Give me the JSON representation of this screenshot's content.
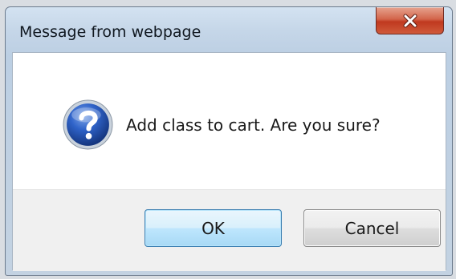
{
  "dialog": {
    "title": "Message from webpage",
    "message": "Add class to cart. Are you sure?",
    "icon": "question-icon",
    "close_icon": "close-icon"
  },
  "buttons": {
    "ok_label": "OK",
    "cancel_label": "Cancel"
  },
  "colors": {
    "close_button": "#c83c22",
    "ok_button_border": "#3c7fb1",
    "question_icon": "#1d4fb0"
  }
}
